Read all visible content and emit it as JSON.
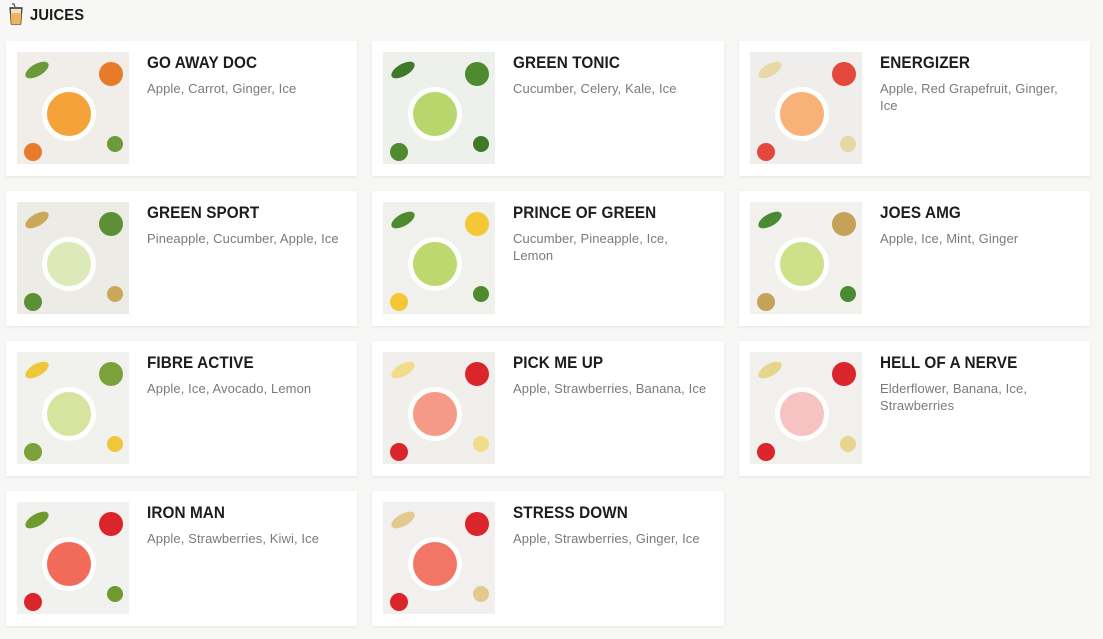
{
  "section": {
    "title": "JUICES",
    "icon": "juice-cup-icon"
  },
  "items": [
    {
      "name": "GO AWAY DOC",
      "ingredients": "Apple, Carrot, Ginger, Ice",
      "colors": {
        "bg": "#f1eee9",
        "drink": "#f6a23b",
        "accent": "#e87a2b",
        "leaf": "#6c9a3a"
      }
    },
    {
      "name": "GREEN TONIC",
      "ingredients": "Cucumber, Celery, Kale, Ice",
      "colors": {
        "bg": "#eef0ec",
        "drink": "#b7d66b",
        "accent": "#4f8a2f",
        "leaf": "#3f7a2a"
      }
    },
    {
      "name": "ENERGIZER",
      "ingredients": "Apple, Red Grapefruit, Ginger, Ice",
      "colors": {
        "bg": "#efeeec",
        "drink": "#f7b27a",
        "accent": "#e4473b",
        "leaf": "#e8d8a8"
      }
    },
    {
      "name": "GREEN SPORT",
      "ingredients": "Pineapple, Cucumber, Apple, Ice",
      "colors": {
        "bg": "#ecebe6",
        "drink": "#dde9b8",
        "accent": "#5d8f34",
        "leaf": "#c9a85a"
      }
    },
    {
      "name": "PRINCE OF GREEN",
      "ingredients": "Cucumber, Pineapple, Ice, Lemon",
      "colors": {
        "bg": "#f0f0ec",
        "drink": "#bcd86e",
        "accent": "#f3c735",
        "leaf": "#4f8a2f"
      }
    },
    {
      "name": "JOES AMG",
      "ingredients": "Apple, Ice, Mint, Ginger",
      "colors": {
        "bg": "#f2f1ee",
        "drink": "#cfe08a",
        "accent": "#c3a35a",
        "leaf": "#4a8a33"
      }
    },
    {
      "name": "FIBRE ACTIVE",
      "ingredients": "Apple, Ice, Avocado, Lemon",
      "colors": {
        "bg": "#f1f1ee",
        "drink": "#d7e4a0",
        "accent": "#7aa13a",
        "leaf": "#f0c63a"
      }
    },
    {
      "name": "PICK ME UP",
      "ingredients": "Apple, Strawberries, Banana, Ice",
      "colors": {
        "bg": "#f1efec",
        "drink": "#f59a86",
        "accent": "#d9252b",
        "leaf": "#f2dc8a"
      }
    },
    {
      "name": "HELL OF A NERVE",
      "ingredients": "Elderflower, Banana, Ice, Strawberries",
      "colors": {
        "bg": "#f2f0ec",
        "drink": "#f6c2c2",
        "accent": "#d9252b",
        "leaf": "#e6d58a"
      }
    },
    {
      "name": "IRON MAN",
      "ingredients": "Apple, Strawberries, Kiwi, Ice",
      "colors": {
        "bg": "#f1f1ef",
        "drink": "#f26a5a",
        "accent": "#d9252b",
        "leaf": "#6f9a2e"
      }
    },
    {
      "name": "STRESS DOWN",
      "ingredients": "Apple, Strawberries, Ginger, Ice",
      "colors": {
        "bg": "#f1f0ee",
        "drink": "#f27666",
        "accent": "#d9252b",
        "leaf": "#e4c98e"
      }
    }
  ]
}
